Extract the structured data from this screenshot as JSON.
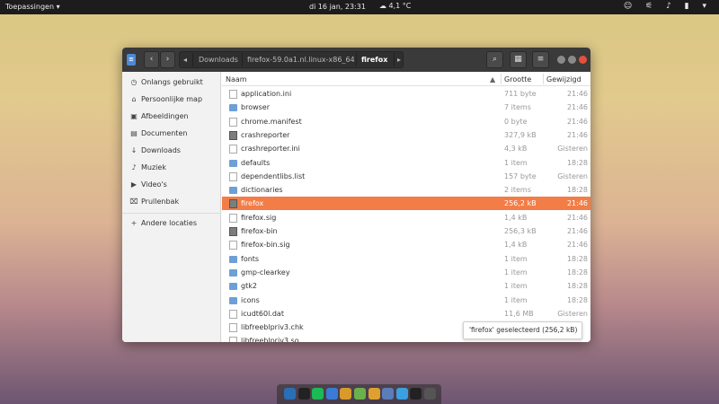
{
  "topbar": {
    "apps_label": "Toepassingen ▾",
    "clock": "di 16 jan, 23:31",
    "weather": "☁ 4,1 °C",
    "tray_icons": [
      "chat-icon",
      "wifi-icon",
      "volume-icon",
      "battery-icon",
      "chevron-down-icon"
    ],
    "tray_glyphs": "☺ ⚟ ♪ ▮ ▾"
  },
  "window": {
    "back_glyph": "‹",
    "forward_glyph": "›",
    "crumb_left_glyph": "◂",
    "crumb_right_glyph": "▸",
    "breadcrumbs": [
      "Downloads",
      "firefox-59.0a1.nl.linux-x86_64",
      "firefox"
    ],
    "toolbar_glyphs": {
      "search": "⌕",
      "view": "▦",
      "menu": "≡"
    }
  },
  "sidebar": {
    "items": [
      {
        "label": "Onlangs gebruikt",
        "glyph": "◷",
        "icon": "clock-icon"
      },
      {
        "label": "Persoonlijke map",
        "glyph": "⌂",
        "icon": "home-icon"
      },
      {
        "label": "Afbeeldingen",
        "glyph": "▣",
        "icon": "camera-icon"
      },
      {
        "label": "Documenten",
        "glyph": "▤",
        "icon": "document-icon"
      },
      {
        "label": "Downloads",
        "glyph": "↓",
        "icon": "download-icon"
      },
      {
        "label": "Muziek",
        "glyph": "♪",
        "icon": "music-icon"
      },
      {
        "label": "Video's",
        "glyph": "▶",
        "icon": "video-icon"
      },
      {
        "label": "Prullenbak",
        "glyph": "⌧",
        "icon": "trash-icon"
      }
    ],
    "other_locations": {
      "label": "Andere locaties",
      "glyph": "+",
      "icon": "plus-icon"
    }
  },
  "list": {
    "columns": {
      "name": "Naam",
      "sort_glyph": "▲",
      "size": "Grootte",
      "modified": "Gewijzigd"
    },
    "rows": [
      {
        "name": "application.ini",
        "size": "711 byte",
        "modified": "21:46",
        "kind": "file"
      },
      {
        "name": "browser",
        "size": "7 items",
        "modified": "21:46",
        "kind": "folder"
      },
      {
        "name": "chrome.manifest",
        "size": "0 byte",
        "modified": "21:46",
        "kind": "file"
      },
      {
        "name": "crashreporter",
        "size": "327,9 kB",
        "modified": "21:46",
        "kind": "exe"
      },
      {
        "name": "crashreporter.ini",
        "size": "4,3 kB",
        "modified": "Gisteren",
        "kind": "file"
      },
      {
        "name": "defaults",
        "size": "1 item",
        "modified": "18:28",
        "kind": "folder"
      },
      {
        "name": "dependentlibs.list",
        "size": "157 byte",
        "modified": "Gisteren",
        "kind": "file"
      },
      {
        "name": "dictionaries",
        "size": "2 items",
        "modified": "18:28",
        "kind": "folder"
      },
      {
        "name": "firefox",
        "size": "256,2 kB",
        "modified": "21:46",
        "kind": "exe",
        "selected": true
      },
      {
        "name": "firefox.sig",
        "size": "1,4 kB",
        "modified": "21:46",
        "kind": "file"
      },
      {
        "name": "firefox-bin",
        "size": "256,3 kB",
        "modified": "21:46",
        "kind": "exe"
      },
      {
        "name": "firefox-bin.sig",
        "size": "1,4 kB",
        "modified": "21:46",
        "kind": "file"
      },
      {
        "name": "fonts",
        "size": "1 item",
        "modified": "18:28",
        "kind": "folder"
      },
      {
        "name": "gmp-clearkey",
        "size": "1 item",
        "modified": "18:28",
        "kind": "folder"
      },
      {
        "name": "gtk2",
        "size": "1 item",
        "modified": "18:28",
        "kind": "folder"
      },
      {
        "name": "icons",
        "size": "1 item",
        "modified": "18:28",
        "kind": "folder"
      },
      {
        "name": "icudt60l.dat",
        "size": "11,6 MB",
        "modified": "Gisteren",
        "kind": "file"
      },
      {
        "name": "libfreeblpriv3.chk",
        "size": "",
        "modified": "",
        "kind": "file"
      },
      {
        "name": "libfreeblpriv3.so",
        "size": "",
        "modified": "",
        "kind": "file"
      }
    ]
  },
  "status": {
    "text": "'firefox' geselecteerd  (256,2 kB)"
  },
  "dock": {
    "items": [
      {
        "icon": "bird-icon",
        "color": "#2a6fb6"
      },
      {
        "icon": "steam-icon",
        "color": "#222222"
      },
      {
        "icon": "spotify-icon",
        "color": "#1db954"
      },
      {
        "icon": "qbittorrent-icon",
        "color": "#3a7bd5"
      },
      {
        "icon": "puzzle-icon",
        "color": "#d89a2a"
      },
      {
        "icon": "rss-icon",
        "color": "#6ab04c"
      },
      {
        "icon": "image-icon",
        "color": "#e0a030"
      },
      {
        "icon": "calculator-icon",
        "color": "#5b7db8"
      },
      {
        "icon": "download-manager-icon",
        "color": "#3aa0e0"
      },
      {
        "icon": "terminal-icon",
        "color": "#222222"
      },
      {
        "icon": "camera-icon",
        "color": "#555555"
      }
    ]
  }
}
